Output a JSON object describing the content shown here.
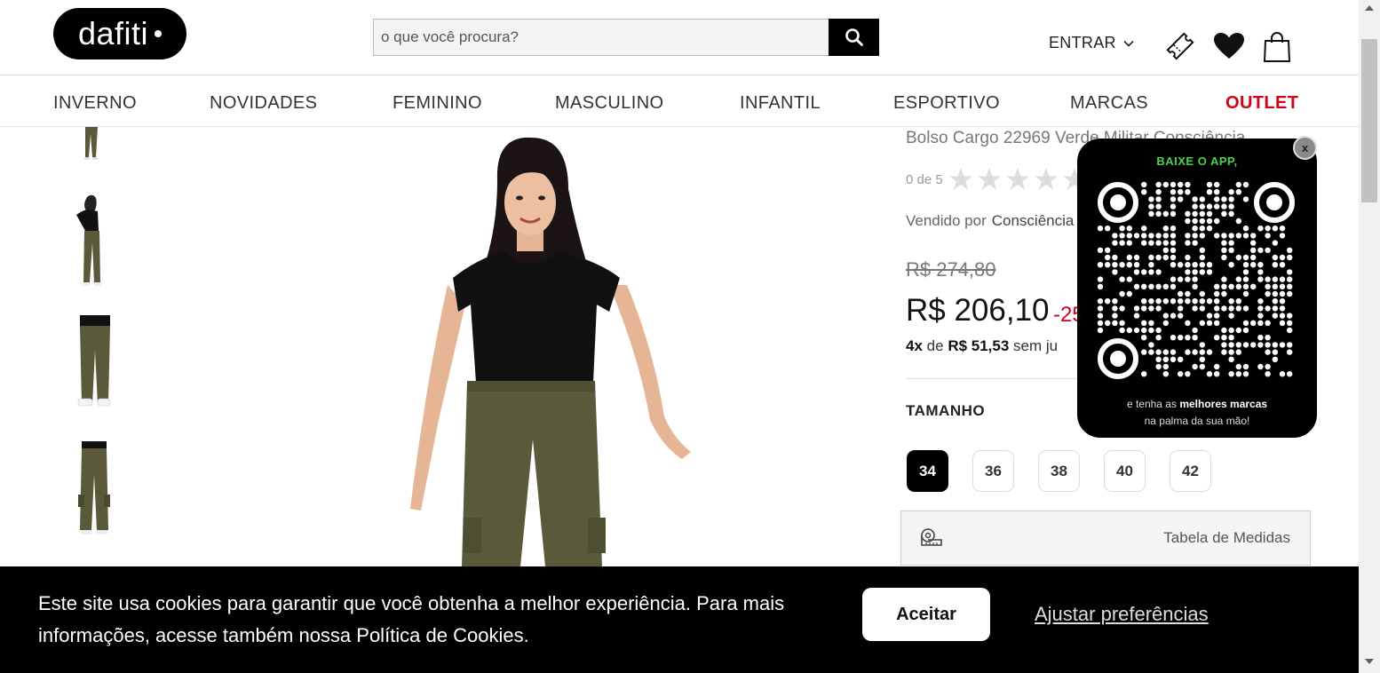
{
  "header": {
    "logo_text": "dafiti",
    "search_placeholder": "o que você procura?",
    "login_label": "ENTRAR"
  },
  "nav": {
    "items": [
      "INVERNO",
      "NOVIDADES",
      "FEMININO",
      "MASCULINO",
      "INFANTIL",
      "ESPORTIVO",
      "MARCAS",
      "OUTLET"
    ]
  },
  "product": {
    "title": "Bolso Cargo 22969 Verde Militar Consciência",
    "rating_label": "0 de 5",
    "seller_label": "Vendido por",
    "seller_name": "Consciência",
    "old_price": "R$ 274,80",
    "price": "R$ 206,10",
    "discount": "-25",
    "installments_count": "4x",
    "installments_de": "de",
    "installments_value": "R$ 51,53",
    "installments_suffix": "sem ju",
    "size_label": "TAMANHO",
    "sizes": [
      "34",
      "36",
      "38",
      "40",
      "42"
    ],
    "selected_size": "34",
    "size_table_label": "Tabela de Medidas"
  },
  "app_promo": {
    "title": "BAIXE O APP,",
    "sub_line1_prefix": "e tenha as",
    "sub_line1_bold": "melhores marcas",
    "sub_line2": "na palma da sua mão!",
    "close_label": "x"
  },
  "cookie": {
    "text": "Este site usa cookies para garantir que você obtenha a melhor experiência. Para mais informações, acesse também nossa Política de Cookies.",
    "accept_label": "Aceitar",
    "prefs_label": "Ajustar preferências"
  },
  "colors": {
    "outlet": "#d0021b",
    "discount": "#d0021b",
    "app_title": "#4cd34c",
    "pants": "#5a5a3a",
    "top": "#111111"
  }
}
